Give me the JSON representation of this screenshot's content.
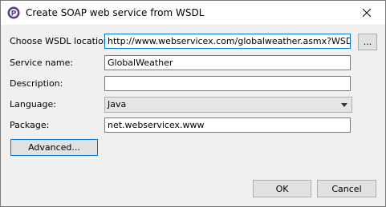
{
  "window": {
    "title": "Create SOAP web service from WSDL"
  },
  "form": {
    "wsdl_label": "Choose WSDL location:",
    "wsdl_value": "http://www.webservicex.com/globalweather.asmx?WSDL",
    "browse_label": "...",
    "service_label": "Service name:",
    "service_value": "GlobalWeather",
    "description_label": "Description:",
    "description_value": "",
    "language_label": "Language:",
    "language_value": "Java",
    "package_label": "Package:",
    "package_value": "net.webservicex.www"
  },
  "buttons": {
    "advanced": "Advanced...",
    "ok": "OK",
    "cancel": "Cancel"
  },
  "icons": {
    "app": "soap-app-icon",
    "close": "close-icon",
    "dropdown": "chevron-down-icon"
  }
}
